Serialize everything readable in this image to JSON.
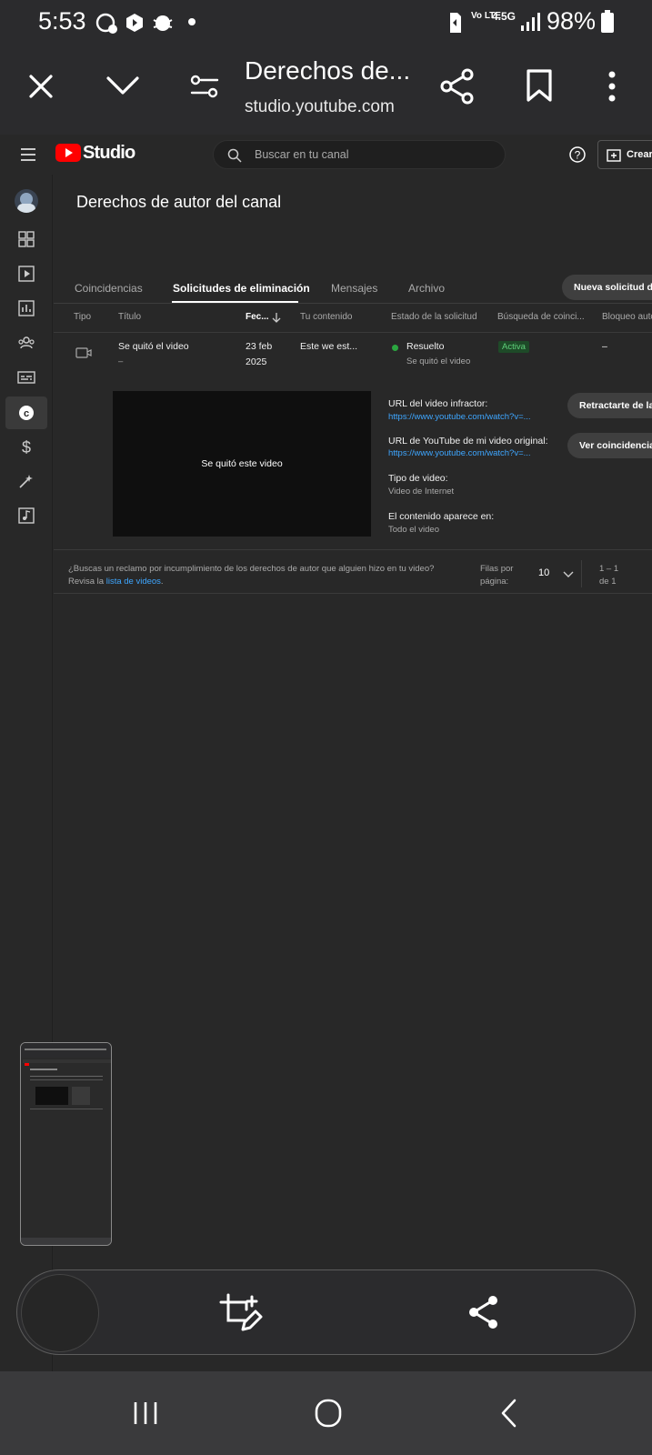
{
  "status_bar": {
    "time": "5:53",
    "network": "4.5G",
    "volte": "Vo LTE",
    "battery": "98%"
  },
  "browser": {
    "page_title": "Derechos de...",
    "url": "studio.youtube.com"
  },
  "studio": {
    "logo_text": "Studio",
    "search_placeholder": "Buscar en tu canal",
    "create_label": "Crear",
    "page_title": "Derechos de autor del canal",
    "tabs": [
      "Coincidencias",
      "Solicitudes de eliminación",
      "Mensajes",
      "Archivo"
    ],
    "new_request_button": "Nueva solicitud d",
    "columns": [
      "Tipo",
      "Título",
      "Fec...",
      "Tu contenido",
      "Estado de la solicitud",
      "Búsqueda de coinci...",
      "Bloqueo auto"
    ],
    "row": {
      "title": "Se quitó el video",
      "title_sub": "–",
      "date_line1": "23 feb",
      "date_line2": "2025",
      "content": "Este we est...",
      "status": "Resuelto",
      "status_sub": "Se quitó el video",
      "match_search": "Activa",
      "auto_block": "–"
    },
    "detail": {
      "preview_text": "Se quitó este video",
      "infringing_url_label": "URL del video infractor:",
      "infringing_url": "https://www.youtube.com/watch?v=...",
      "original_url_label": "URL de YouTube de mi video original:",
      "original_url": "https://www.youtube.com/watch?v=...",
      "video_type_label": "Tipo de video:",
      "video_type": "Video de Internet",
      "appears_in_label": "El contenido aparece en:",
      "appears_in": "Todo el video",
      "retract_button": "Retractarte de la",
      "see_matches_button": "Ver coincidencias"
    },
    "footer": {
      "question": "¿Buscas un reclamo por incumplimiento de los derechos de autor que alguien hizo en tu video?",
      "review_prefix": "Revisa la ",
      "review_link": "lista de videos",
      "review_suffix": ".",
      "rows_per_page_line1": "Filas por",
      "rows_per_page_line2": "página:",
      "rows_per_page_value": "10",
      "range_line1": "1 – 1",
      "range_line2": "de 1"
    }
  },
  "colors": {
    "brand_red": "#ff0000",
    "status_green": "#2ba640",
    "link_blue": "#3ea6ff"
  }
}
